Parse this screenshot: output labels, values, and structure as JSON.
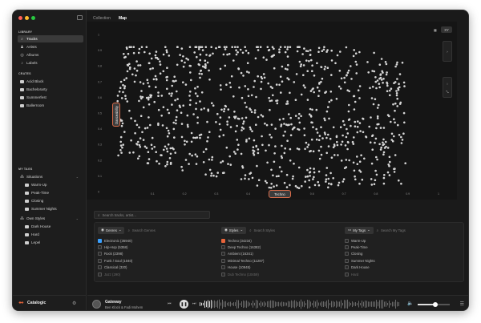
{
  "colors": {
    "accent": "#e8643a",
    "blue": "#3aa0ff",
    "window_bg": "#1a1a1a",
    "point": "#d6d6d6"
  },
  "header": {
    "crumb": "Collection",
    "title": "Map"
  },
  "sidebar": {
    "library_title": "LIBRARY",
    "library": [
      {
        "label": "Tracks",
        "icon": "search-icon"
      },
      {
        "label": "Artists",
        "icon": "artists-icon"
      },
      {
        "label": "Albums",
        "icon": "album-icon"
      },
      {
        "label": "Labels",
        "icon": "label-icon"
      }
    ],
    "crates_title": "CRATES",
    "crates": [
      "Acid Black",
      "Bachelorarty",
      "Summerfest",
      "Ballerroom"
    ],
    "tags_title": "MY TAGS",
    "situations": {
      "label": "Situations",
      "items": [
        "Warm-Up",
        "Peak-Time",
        "Closing",
        "Summer Nights"
      ]
    },
    "own_styles": {
      "label": "Own Styles",
      "items": [
        "Dark House",
        "Hard",
        "Lepel"
      ]
    }
  },
  "brand": {
    "name": "Catalogic"
  },
  "map": {
    "y_axis_tag": "Danceability",
    "x_axis_tag": "Techno",
    "y_ticks": [
      "1",
      "0.9",
      "0.8",
      "0.7",
      "0.6",
      "0.5",
      "0.4",
      "0.3",
      "0.2",
      "0.1",
      "0"
    ],
    "x_ticks": [
      "0.1",
      "0.2",
      "0.3",
      "0.4",
      "0.5",
      "0.6",
      "0.7",
      "0.8",
      "0.9",
      "1"
    ],
    "mode_label": "XY"
  },
  "search": {
    "placeholder": "Search tracks, artist..."
  },
  "filters": {
    "genres": {
      "button": "Genres",
      "placeholder": "Search Genres",
      "items": [
        "Electronic (36940)",
        "Hip-Hop (5358)",
        "Rock (2398)",
        "Funk / Soul (1040)",
        "Classical (320)",
        "Jazz (290)"
      ]
    },
    "styles": {
      "button": "Styles",
      "placeholder": "Search Styles",
      "items": [
        "Techno (34234)",
        "Deep Techno (16382)",
        "Ambient (16341)",
        "Minimal Techno (11287)",
        "House (10945)",
        "Dub Techno (10459)"
      ]
    },
    "tags": {
      "button": "My Tags",
      "placeholder": "Search My Tags",
      "items": [
        "Warm-Up",
        "Peak-Time",
        "Closing",
        "Summer Nights",
        "Dark House",
        "Hard"
      ]
    }
  },
  "player": {
    "title": "Gateway",
    "artist": "Ben Klock & Fadi Mohem",
    "volume": 0.55
  }
}
